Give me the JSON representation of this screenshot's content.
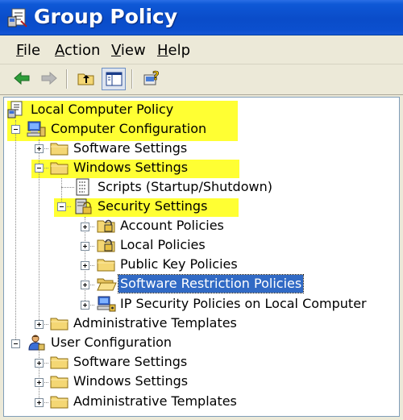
{
  "window": {
    "title": "Group Policy"
  },
  "menu": [
    {
      "accel": "F",
      "rest": "ile"
    },
    {
      "accel": "A",
      "rest": "ction"
    },
    {
      "accel": "V",
      "rest": "iew"
    },
    {
      "accel": "H",
      "rest": "elp"
    }
  ],
  "tree": {
    "root": "Local Computer Policy",
    "computer_config": "Computer Configuration",
    "cc_software": "Software Settings",
    "cc_windows": "Windows Settings",
    "scripts": "Scripts (Startup/Shutdown)",
    "security": "Security Settings",
    "account": "Account Policies",
    "local": "Local Policies",
    "pubkey": "Public Key Policies",
    "srp": "Software Restriction Policies",
    "ipsec": "IP Security Policies on Local Computer",
    "cc_admin": "Administrative Templates",
    "user_config": "User Configuration",
    "uc_software": "Software Settings",
    "uc_windows": "Windows Settings",
    "uc_admin": "Administrative Templates"
  },
  "colors": {
    "highlight": "#ffff33",
    "selection": "#316ac5",
    "titlebar": "#0a4cc9"
  }
}
